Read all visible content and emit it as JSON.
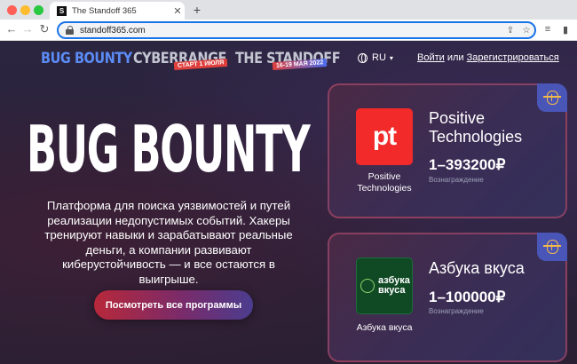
{
  "browser": {
    "tab_title": "The Standoff 365",
    "tab_favicon": "S",
    "url": "standoff365.com",
    "icons": [
      "lock-icon",
      "share-icon",
      "star-icon",
      "reading-list-icon",
      "sidebar-icon"
    ]
  },
  "nav": {
    "logo_bug_bounty": "BUG BOUNTY",
    "logo_cyberrange": "CYBERRANGE",
    "cyberrange_badge": "СТАРТ 1 ИЮЛЯ",
    "logo_standoff": "THE STANDOFF",
    "standoff_badge": "16-19 МАЯ 2022",
    "language": "RU",
    "login": "Войти",
    "or": "или",
    "register": "Зарегистрироваться"
  },
  "hero": {
    "title": "BUG BOUNTY",
    "description": "Платформа для поиска уязвимостей и путей реализации недопустимых событий. Хакеры тренируют навыки и зарабатывают реальные деньги, а компании развивают киберустойчивость — и все остаются в выигрыше.",
    "cta": "Посмотреть все программы"
  },
  "programs": [
    {
      "logo_text": "pt",
      "caption": "Positive Technologies",
      "name": "Positive Technologies",
      "reward": "1–393200₽",
      "reward_label": "Вознаграждение"
    },
    {
      "logo_text": "азбука вкуса",
      "caption": "Азбука вкуса",
      "name": "Азбука вкуса",
      "reward": "1–100000₽",
      "reward_label": "Вознаграждение"
    }
  ],
  "colors": {
    "accent_blue": "#5b8cf5",
    "pt_red": "#f22a2a",
    "av_green": "#0f4a25",
    "bug_yellow": "#f2b84b"
  }
}
